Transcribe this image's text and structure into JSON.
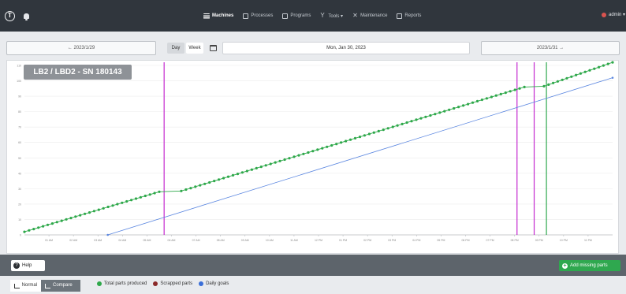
{
  "topbar": {
    "nav": [
      {
        "label": "Machines",
        "icon": "list-icon",
        "active": true
      },
      {
        "label": "Processes",
        "icon": "document-icon",
        "active": false
      },
      {
        "label": "Programs",
        "icon": "program-icon",
        "active": false
      },
      {
        "label": "Tools ▾",
        "icon": "tools-icon",
        "active": false
      },
      {
        "label": "Maintenance",
        "icon": "wrench-icon",
        "active": false
      },
      {
        "label": "Reports",
        "icon": "report-icon",
        "active": false
      }
    ],
    "user": "admin ▾"
  },
  "date_nav": {
    "prev_label": "← 2023/1/29",
    "next_label": "2023/1/31 →",
    "day_label": "Day",
    "week_label": "Week",
    "current_date": "Mon, Jan 30, 2023"
  },
  "badge": "LB2 / LBD2 - SN 180143",
  "actions": {
    "help_label": "Help",
    "add_label": "Add missing parts"
  },
  "view_modes": {
    "normal_label": "Normal",
    "compare_label": "Compare"
  },
  "legend": [
    {
      "label": "Total parts produced",
      "color": "#2ea84a"
    },
    {
      "label": "Scrapped parts",
      "color": "#8b2a2a"
    },
    {
      "label": "Daily goals",
      "color": "#3b6fd8"
    }
  ],
  "chart_data": {
    "type": "line",
    "x_range": [
      0,
      24
    ],
    "y_range": [
      0,
      110
    ],
    "y_ticks": [
      0,
      10,
      20,
      30,
      40,
      50,
      60,
      70,
      80,
      90,
      100,
      110
    ],
    "x_ticks": [
      {
        "x": 1,
        "label": "01 AM"
      },
      {
        "x": 2,
        "label": "02 AM"
      },
      {
        "x": 3,
        "label": "03 AM"
      },
      {
        "x": 4,
        "label": "04 AM"
      },
      {
        "x": 5,
        "label": "05 AM"
      },
      {
        "x": 6,
        "label": "06 AM"
      },
      {
        "x": 7,
        "label": "07 AM"
      },
      {
        "x": 8,
        "label": "08 AM"
      },
      {
        "x": 9,
        "label": "09 AM"
      },
      {
        "x": 10,
        "label": "10 AM"
      },
      {
        "x": 11,
        "label": "11 AM"
      },
      {
        "x": 12,
        "label": "12 PM"
      },
      {
        "x": 13,
        "label": "01 PM"
      },
      {
        "x": 14,
        "label": "02 PM"
      },
      {
        "x": 15,
        "label": "03 PM"
      },
      {
        "x": 16,
        "label": "04 PM"
      },
      {
        "x": 17,
        "label": "05 PM"
      },
      {
        "x": 18,
        "label": "06 PM"
      },
      {
        "x": 19,
        "label": "07 PM"
      },
      {
        "x": 20,
        "label": "08 PM"
      },
      {
        "x": 21,
        "label": "09 PM"
      },
      {
        "x": 22,
        "label": "10 PM"
      },
      {
        "x": 23,
        "label": "11 PM"
      }
    ],
    "series": [
      {
        "name": "Total parts produced",
        "color": "#2ea84a",
        "points": [
          [
            0,
            2
          ],
          [
            5.5,
            28
          ],
          [
            6.4,
            28.5
          ],
          [
            20.4,
            96
          ],
          [
            21.2,
            96.5
          ],
          [
            24,
            112
          ]
        ]
      },
      {
        "name": "Daily goals",
        "color": "#5a86e0",
        "points": [
          [
            3.4,
            0
          ],
          [
            24,
            102
          ]
        ]
      }
    ],
    "markers": [
      {
        "x": 5.7,
        "color": "#c42ad0"
      },
      {
        "x": 20.1,
        "color": "#c42ad0"
      },
      {
        "x": 20.8,
        "color": "#c42ad0"
      },
      {
        "x": 21.3,
        "color": "#2fa84f"
      }
    ]
  }
}
